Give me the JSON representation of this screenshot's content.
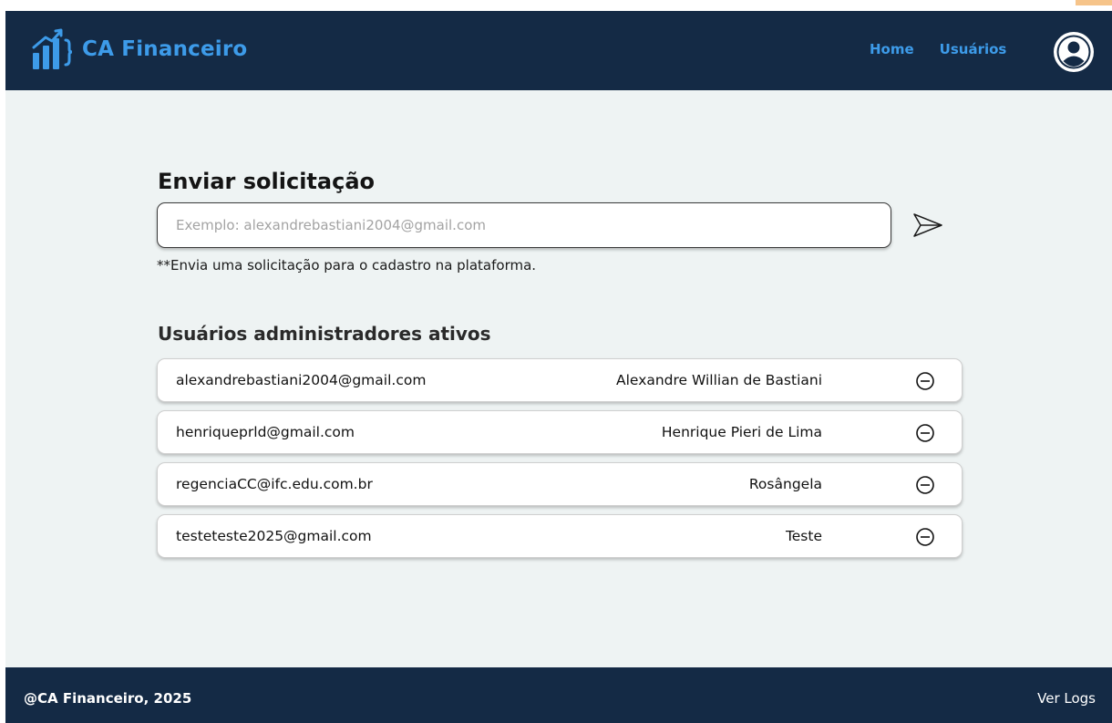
{
  "header": {
    "brand": "CA Financeiro",
    "nav": [
      {
        "label": "Home"
      },
      {
        "label": "Usuários"
      }
    ]
  },
  "request": {
    "title": "Enviar solicitação",
    "placeholder": "Exemplo: alexandrebastiani2004@gmail.com",
    "value": "",
    "hint": "**Envia uma solicitação para o cadastro na plataforma."
  },
  "admins": {
    "title": "Usuários administradores ativos",
    "rows": [
      {
        "email": "alexandrebastiani2004@gmail.com",
        "name": "Alexandre Willian de Bastiani"
      },
      {
        "email": "henriqueprld@gmail.com",
        "name": "Henrique Pieri de Lima"
      },
      {
        "email": "regenciaCC@ifc.edu.com.br",
        "name": "Rosângela"
      },
      {
        "email": "testeteste2025@gmail.com",
        "name": "Teste"
      }
    ]
  },
  "footer": {
    "copyright": "@CA Financeiro, 2025",
    "logs_label": "Ver Logs"
  },
  "icons": {
    "logo": "chart-bars-braces-icon",
    "avatar": "user-avatar-icon",
    "send": "paper-plane-icon",
    "remove": "minus-circle-icon"
  },
  "colors": {
    "header_bg": "#142a45",
    "accent": "#3d9be9",
    "page_bg": "#eef3f3",
    "corner_mark": "#f6c48a"
  }
}
